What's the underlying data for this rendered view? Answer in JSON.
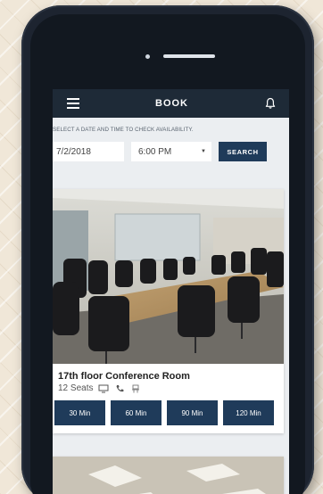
{
  "appbar": {
    "title": "BOOK",
    "menu_icon": "hamburger-menu-icon",
    "notifications_icon": "bell-icon"
  },
  "filters": {
    "instruction": "SELECT A DATE AND TIME TO CHECK AVAILABILITY.",
    "date_value": "7/2/2018",
    "time_value": "6:00 PM",
    "search_label": "SEARCH"
  },
  "rooms": [
    {
      "name": "17th floor Conference Room",
      "seats": "12 Seats",
      "amenities": [
        "monitor-icon",
        "phone-icon",
        "chair-icon"
      ],
      "durations": [
        "30 Min",
        "60 Min",
        "90 Min",
        "120 Min"
      ]
    }
  ],
  "colors": {
    "appbar": "#1e2a37",
    "button": "#1f3b5a",
    "screen_bg": "#ebeef1"
  }
}
